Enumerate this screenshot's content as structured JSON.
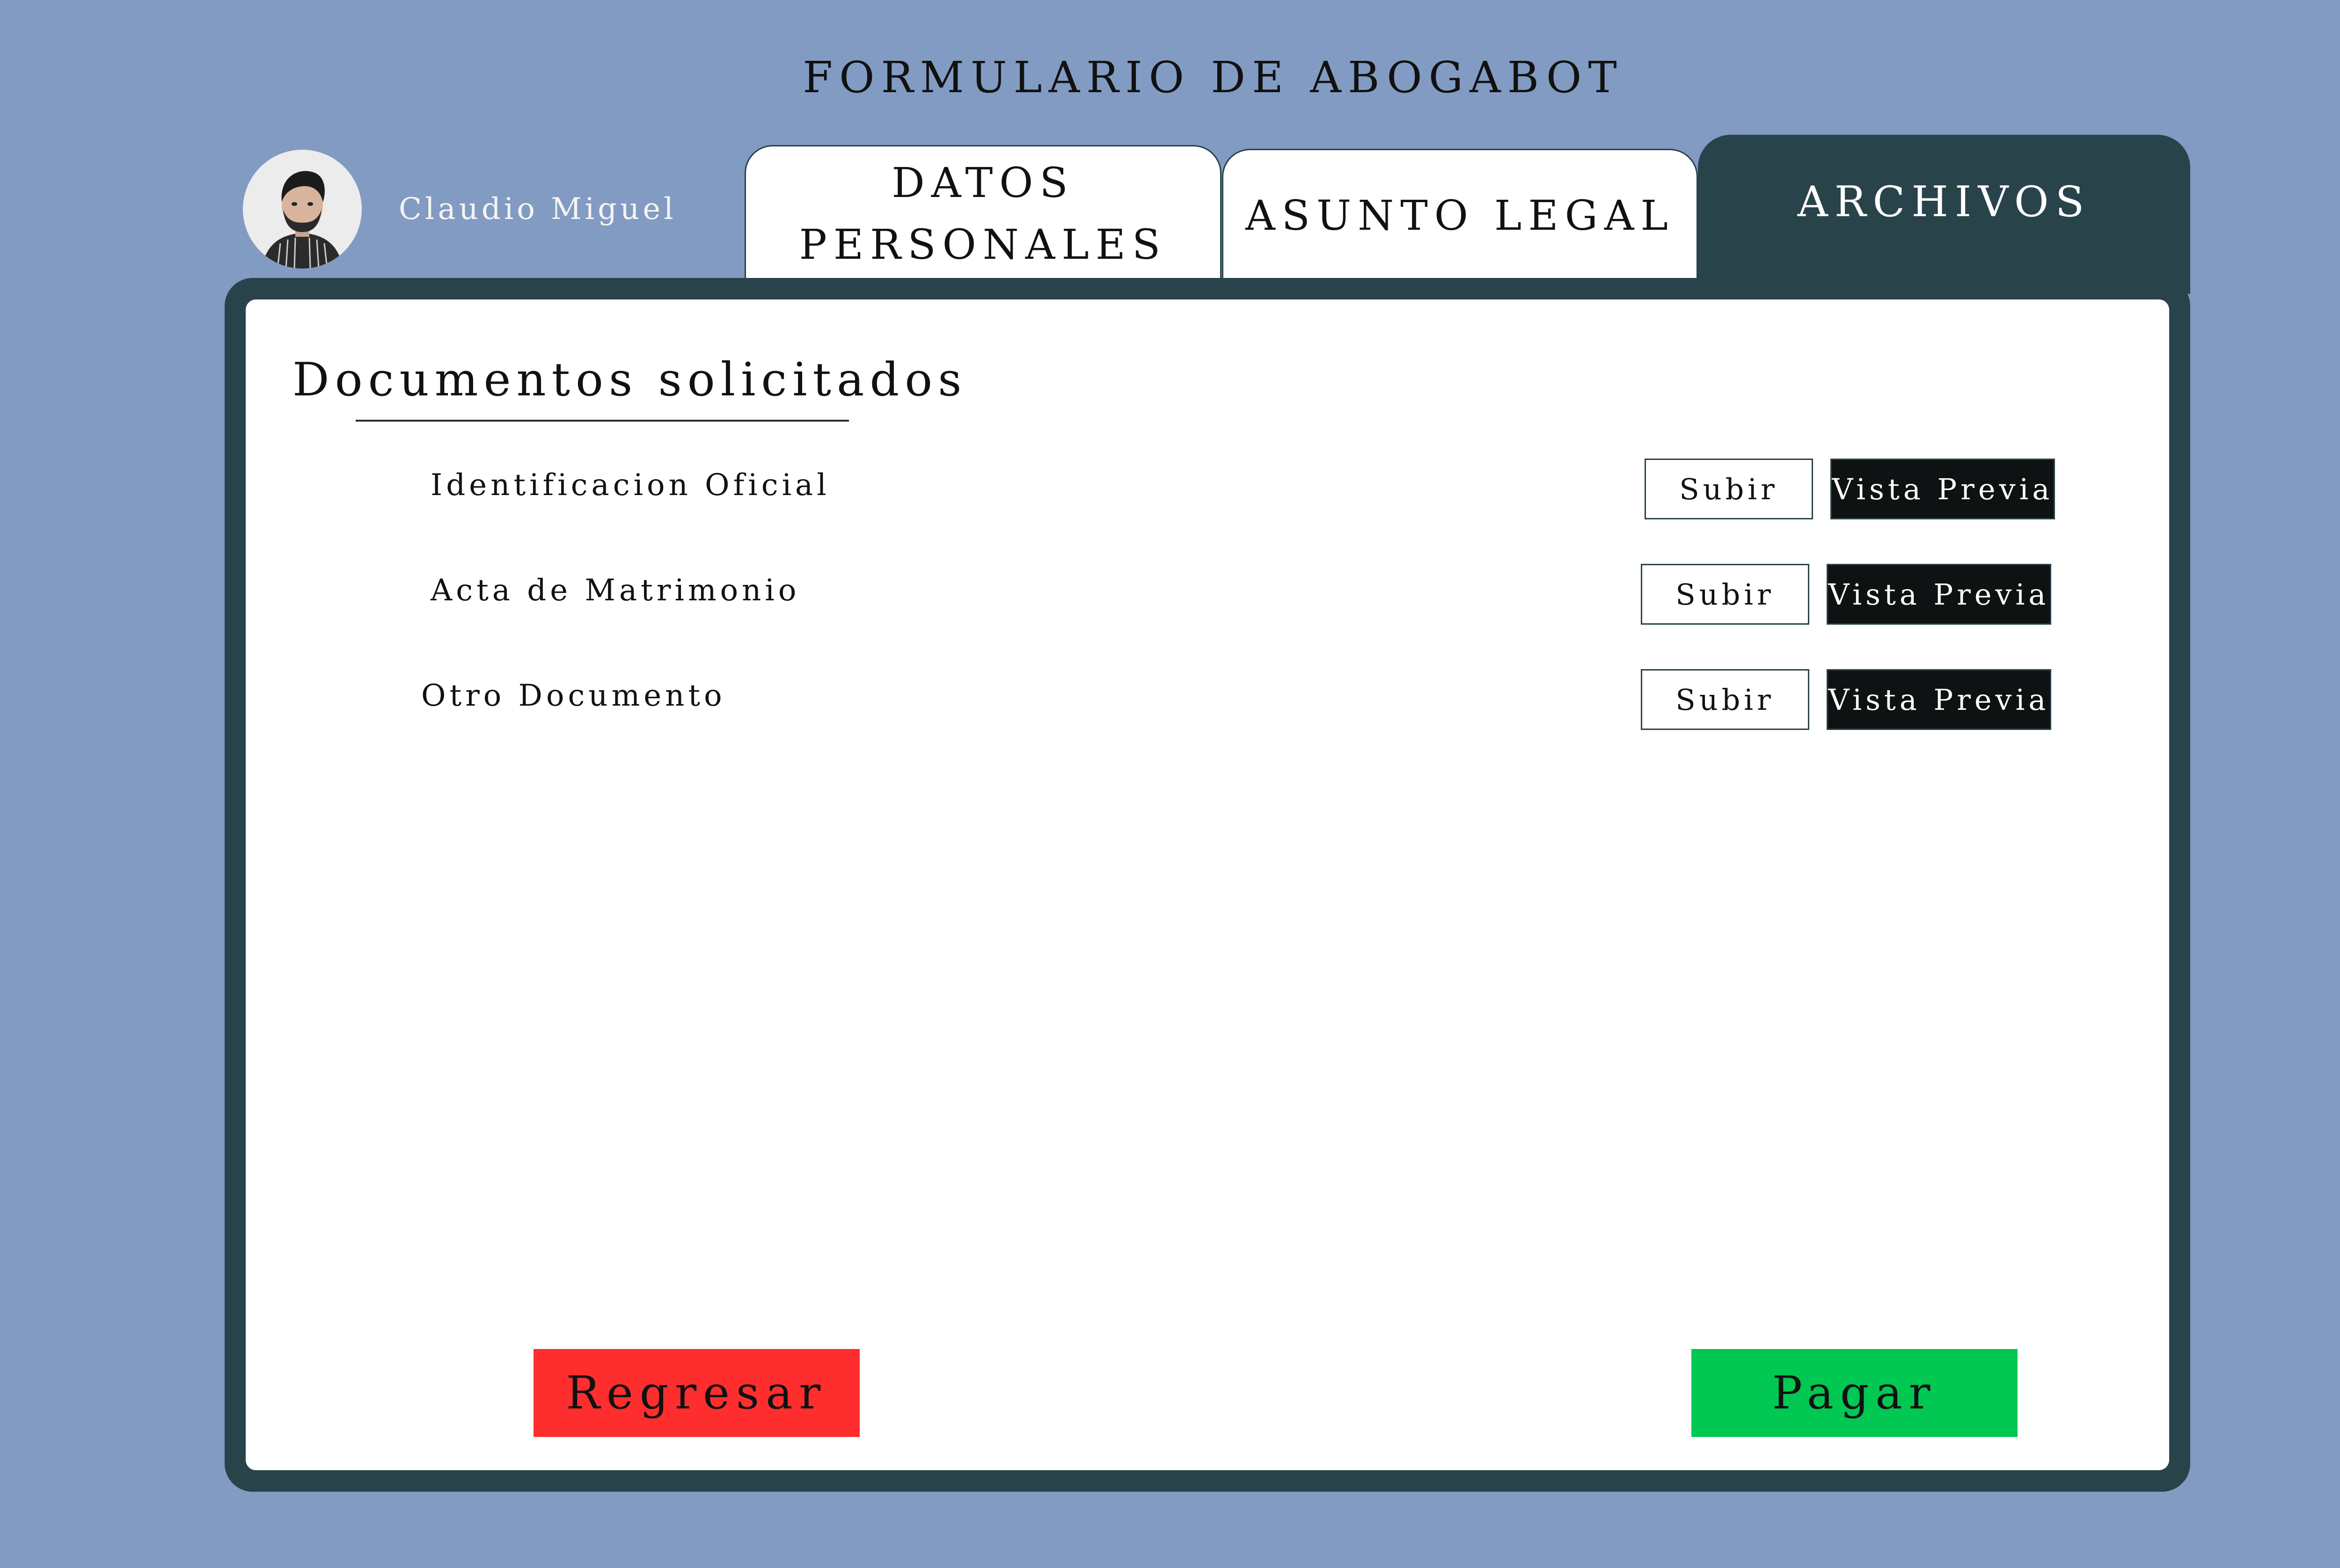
{
  "header": {
    "title": "FORMULARIO DE ABOGABOT"
  },
  "user": {
    "name": "Claudio Miguel",
    "avatar_icon": "user-avatar-icon"
  },
  "tabs": [
    {
      "label": "DATOS PERSONALES",
      "active": false
    },
    {
      "label": "ASUNTO LEGAL",
      "active": false
    },
    {
      "label": "ARCHIVOS",
      "active": true
    }
  ],
  "main": {
    "section_title": "Documentos solicitados",
    "documents": [
      {
        "label": "Identificacion Oficial",
        "upload_label": "Subir",
        "preview_label": "Vista Previa"
      },
      {
        "label": "Acta de Matrimonio",
        "upload_label": "Subir",
        "preview_label": "Vista Previa"
      },
      {
        "label": "Otro Documento",
        "upload_label": "Subir",
        "preview_label": "Vista Previa"
      }
    ]
  },
  "footer": {
    "back_label": "Regresar",
    "pay_label": "Pagar"
  },
  "colors": {
    "background": "#829bc2",
    "frame": "#29434a",
    "back_button": "#ff2e2e",
    "pay_button": "#00c853",
    "preview_button": "#0f1212"
  }
}
